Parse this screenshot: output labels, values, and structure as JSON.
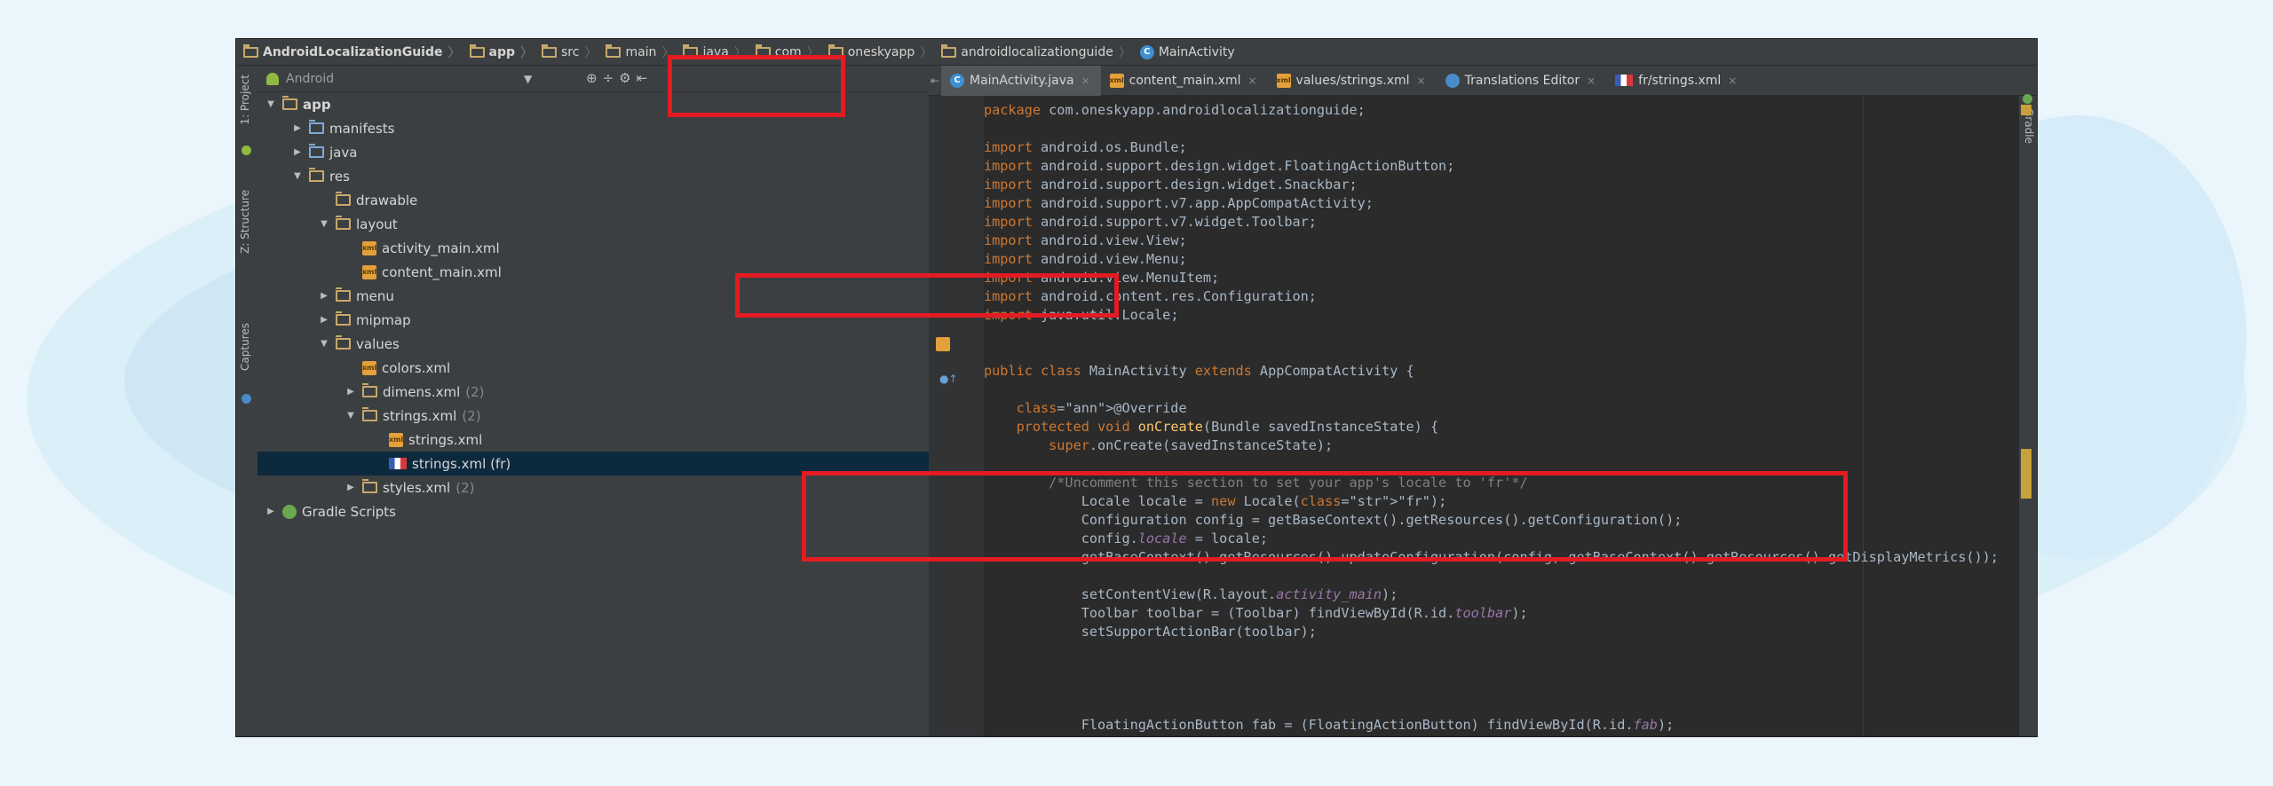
{
  "breadcrumbs": [
    {
      "label": "AndroidLocalizationGuide",
      "icon": "folder-icon",
      "bold": true
    },
    {
      "label": "app",
      "icon": "folder-icon",
      "bold": true
    },
    {
      "label": "src",
      "icon": "folder-icon"
    },
    {
      "label": "main",
      "icon": "folder-icon"
    },
    {
      "label": "java",
      "icon": "folder-icon"
    },
    {
      "label": "com",
      "icon": "folder-icon"
    },
    {
      "label": "oneskyapp",
      "icon": "folder-icon"
    },
    {
      "label": "androidlocalizationguide",
      "icon": "folder-icon"
    },
    {
      "label": "MainActivity",
      "icon": "class-icon"
    }
  ],
  "tool_strip": {
    "project_label": "1: Project",
    "structure_label": "Z: Structure",
    "captures_label": "Captures"
  },
  "project": {
    "view_label": "Android",
    "tree": [
      {
        "label": "app",
        "arrow": "▼",
        "icon": "folder",
        "bold": true,
        "indent": 0
      },
      {
        "label": "manifests",
        "arrow": "▶",
        "icon": "folder-blue",
        "indent": 1
      },
      {
        "label": "java",
        "arrow": "▶",
        "icon": "folder-blue",
        "indent": 1
      },
      {
        "label": "res",
        "arrow": "▼",
        "icon": "folder",
        "indent": 1
      },
      {
        "label": "drawable",
        "arrow": "",
        "icon": "folder",
        "indent": 2
      },
      {
        "label": "layout",
        "arrow": "▼",
        "icon": "folder",
        "indent": 2
      },
      {
        "label": "activity_main.xml",
        "arrow": "",
        "icon": "xml",
        "indent": 3
      },
      {
        "label": "content_main.xml",
        "arrow": "",
        "icon": "xml",
        "indent": 3
      },
      {
        "label": "menu",
        "arrow": "▶",
        "icon": "folder",
        "indent": 2
      },
      {
        "label": "mipmap",
        "arrow": "▶",
        "icon": "folder",
        "indent": 2
      },
      {
        "label": "values",
        "arrow": "▼",
        "icon": "folder",
        "indent": 2
      },
      {
        "label": "colors.xml",
        "arrow": "",
        "icon": "xml",
        "indent": 3
      },
      {
        "label": "dimens.xml",
        "count": "(2)",
        "arrow": "▶",
        "icon": "folder",
        "indent": 3
      },
      {
        "label": "strings.xml",
        "count": "(2)",
        "arrow": "▼",
        "icon": "folder",
        "indent": 3
      },
      {
        "label": "strings.xml",
        "arrow": "",
        "icon": "xml",
        "indent": 4
      },
      {
        "label": "strings.xml (fr)",
        "arrow": "",
        "icon": "flag",
        "indent": 4,
        "selected": true
      },
      {
        "label": "styles.xml",
        "count": "(2)",
        "arrow": "▶",
        "icon": "folder",
        "indent": 3
      },
      {
        "label": "Gradle Scripts",
        "arrow": "▶",
        "icon": "gradle",
        "indent": 0
      }
    ]
  },
  "tabs": [
    {
      "label": "MainActivity.java",
      "icon": "class",
      "active": true
    },
    {
      "label": "content_main.xml",
      "icon": "xml"
    },
    {
      "label": "values/strings.xml",
      "icon": "xml"
    },
    {
      "label": "Translations Editor",
      "icon": "globe"
    },
    {
      "label": "fr/strings.xml",
      "icon": "flag"
    }
  ],
  "right_panel_label": "Gradle",
  "code_lines": [
    "package com.oneskyapp.androidlocalizationguide;",
    "",
    "import android.os.Bundle;",
    "import android.support.design.widget.FloatingActionButton;",
    "import android.support.design.widget.Snackbar;",
    "import android.support.v7.app.AppCompatActivity;",
    "import android.support.v7.widget.Toolbar;",
    "import android.view.View;",
    "import android.view.Menu;",
    "import android.view.MenuItem;",
    "import android.content.res.Configuration;",
    "import java.util.Locale;",
    "",
    "",
    "public class MainActivity extends AppCompatActivity {",
    "",
    "    @Override",
    "    protected void onCreate(Bundle savedInstanceState) {",
    "        super.onCreate(savedInstanceState);",
    "",
    "        /*Uncomment this section to set your app's locale to 'fr'*/",
    "            Locale locale = new Locale(\"fr\");",
    "            Configuration config = getBaseContext().getResources().getConfiguration();",
    "            config.locale = locale;",
    "            getBaseContext().getResources().updateConfiguration(config, getBaseContext().getResources().getDisplayMetrics());",
    "",
    "            setContentView(R.layout.activity_main);",
    "            Toolbar toolbar = (Toolbar) findViewById(R.id.toolbar);",
    "            setSupportActionBar(toolbar);",
    "",
    "",
    "",
    "",
    "            FloatingActionButton fab = (FloatingActionButton) findViewById(R.id.fab);"
  ]
}
